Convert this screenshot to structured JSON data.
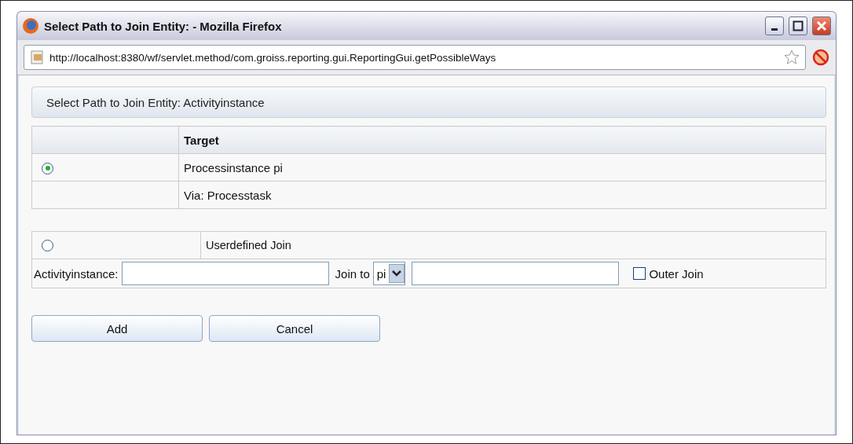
{
  "window": {
    "title": "Select Path to Join Entity: - Mozilla Firefox"
  },
  "address_bar": {
    "url": "http://localhost:8380/wf/servlet.method/com.groiss.reporting.gui.ReportingGui.getPossibleWays"
  },
  "heading": "Select Path to Join Entity: Activityinstance",
  "paths_table": {
    "columns": [
      {
        "label": "Target"
      }
    ],
    "rows": [
      {
        "kind": "option",
        "selected": true,
        "target": "Processinstance pi"
      },
      {
        "kind": "detail",
        "target": "Via: Processtask"
      }
    ]
  },
  "userdefined": {
    "selected": false,
    "label": "Userdefined Join",
    "source_label": "Activityinstance:",
    "join_label": "Join to",
    "join_select": {
      "value": "pi"
    },
    "outer_join": {
      "label": "Outer Join",
      "checked": false
    }
  },
  "buttons": [
    "Add",
    "Cancel"
  ]
}
